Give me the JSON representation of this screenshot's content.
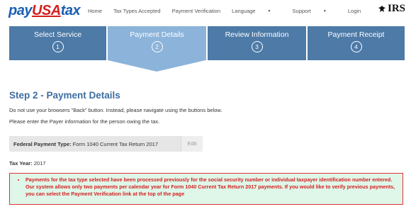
{
  "logo": {
    "part1": "pay",
    "part2": "USA",
    "part3": "tax"
  },
  "nav": {
    "home": "Home",
    "tax_types": "Tax Types Accepted",
    "payment_verification": "Payment Verification",
    "language": "Language",
    "support": "Support",
    "login": "Login"
  },
  "irs_label": "IRS",
  "steps": [
    {
      "label": "Select Service",
      "num": "1",
      "active": false
    },
    {
      "label": "Payment Details",
      "num": "2",
      "active": true
    },
    {
      "label": "Review Information",
      "num": "3",
      "active": false
    },
    {
      "label": "Payment Receipt",
      "num": "4",
      "active": false
    }
  ],
  "page": {
    "title": "Step 2 - Payment Details",
    "p1": "Do not use your browsers \"Back\" button. Instead, please navigate using the buttons below.",
    "p2": "Please enter the Payer information for the person owing the tax.",
    "fed_label": "Federal Payment Type:",
    "fed_value": " Form 1040 Current Tax Return 2017",
    "edit_label": "Edit",
    "tax_year_label": "Tax Year:",
    "tax_year_value": " 2017",
    "alert_text": "Payments for the tax type selected have been processed previously for the social security number or individual taxpayer identification number entered. Our system allows only two payments per calendar year for Form 1040 Current Tax Return 2017 payments. If you would like to verify previous payments, you can select the Payment Verification link at the top of the page"
  },
  "colors": {
    "step_dark": "#4d7aa7",
    "step_active": "#8cb3d9",
    "title_blue": "#3c6ea0",
    "alert_red": "#d42020",
    "alert_bg": "#dff7e9"
  }
}
